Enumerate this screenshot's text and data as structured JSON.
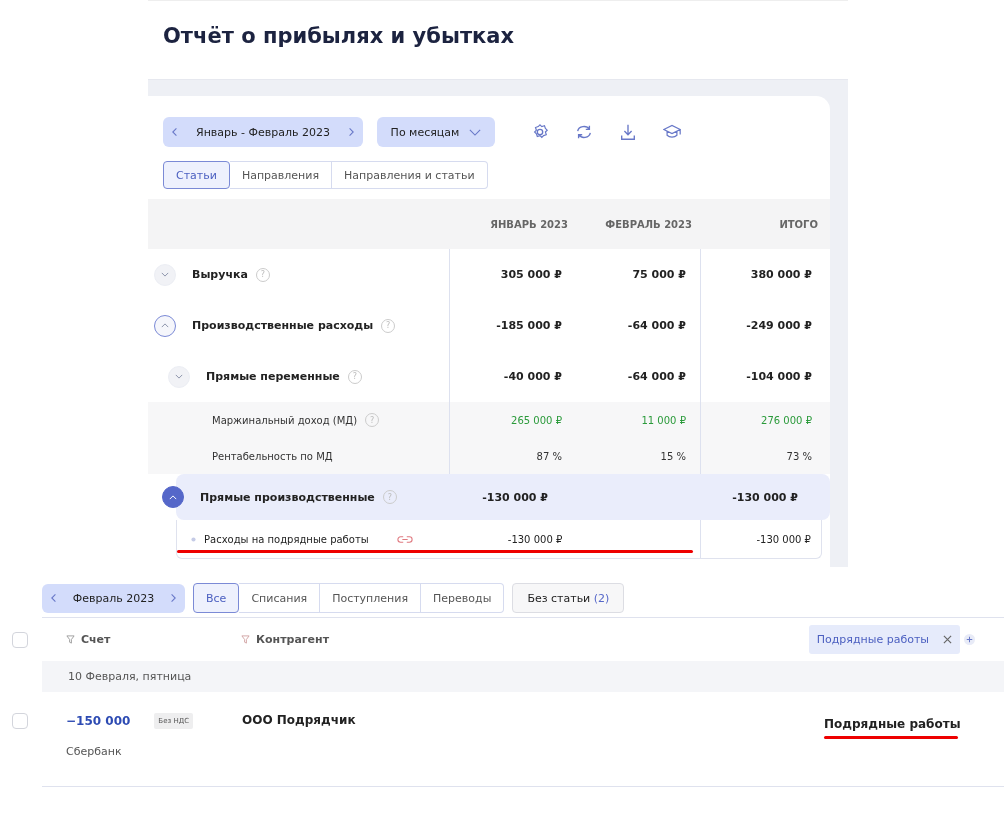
{
  "title": "Отчёт о прибылях и убытках",
  "report": {
    "period": "Январь - Февраль 2023",
    "grouping": "По месяцам",
    "tabs": [
      {
        "label": "Статьи",
        "selected": true
      },
      {
        "label": "Направления",
        "selected": false
      },
      {
        "label": "Направления и статьи",
        "selected": false
      }
    ],
    "columns": [
      "ЯНВАРЬ 2023",
      "ФЕВРАЛЬ 2023",
      "ИТОГО"
    ],
    "rows": [
      {
        "kind": "group",
        "label": "Выручка",
        "help": "?",
        "expanded": false,
        "selected": false,
        "values": {
          "january": "305 000 ₽",
          "february": "75 000 ₽",
          "total": "380 000 ₽"
        }
      },
      {
        "kind": "group",
        "label": "Производственные расходы",
        "help": "?",
        "expanded": true,
        "selected": false,
        "values": {
          "january": "-185 000 ₽",
          "february": "-64 000 ₽",
          "total": "-249 000 ₽"
        },
        "children": [
          {
            "kind": "group",
            "label": "Прямые переменные",
            "help": "?",
            "expanded": false,
            "selected": false,
            "values": {
              "january": "-40 000 ₽",
              "february": "-64 000 ₽",
              "total": "-104 000 ₽"
            }
          },
          {
            "kind": "metric",
            "label": "Маржинальный доход (МД)",
            "help": "?",
            "positive": true,
            "values": {
              "january": "265 000 ₽",
              "february": "11 000 ₽",
              "total": "276 000 ₽"
            }
          },
          {
            "kind": "metric",
            "label": "Рентабельность по МД",
            "positive": false,
            "values": {
              "january": "87 %",
              "february": "15 %",
              "total": "73 %"
            }
          },
          {
            "kind": "group",
            "label": "Прямые производственные",
            "help": "?",
            "expanded": true,
            "selected": true,
            "values": {
              "january": "-130 000 ₽",
              "total": "-130 000 ₽"
            },
            "children": [
              {
                "kind": "leaf",
                "label": "Расходы на подрядные работы",
                "linked": true,
                "values": {
                  "january": "-130 000 ₽",
                  "total": "-130 000 ₽"
                }
              }
            ]
          }
        ]
      }
    ]
  },
  "operations": {
    "period": "Февраль 2023",
    "tabs": [
      {
        "label": "Все",
        "selected": true
      },
      {
        "label": "Списания",
        "selected": false
      },
      {
        "label": "Поступления",
        "selected": false
      },
      {
        "label": "Переводы",
        "selected": false
      }
    ],
    "uncategorized": {
      "label": "Без статьи",
      "count": "(2)"
    },
    "select_all": {
      "checked": false
    },
    "columns": [
      "Счет",
      "Контрагент"
    ],
    "filter_chip": "Подрядные работы",
    "date": "10 Февраля, пятница",
    "transactions": [
      {
        "checked": false,
        "amount": "−150 000",
        "vat": "Без НДС",
        "account": "Сбербанк",
        "counterparty": "ООО Подрядчик",
        "category": "Подрядные работы"
      }
    ]
  }
}
